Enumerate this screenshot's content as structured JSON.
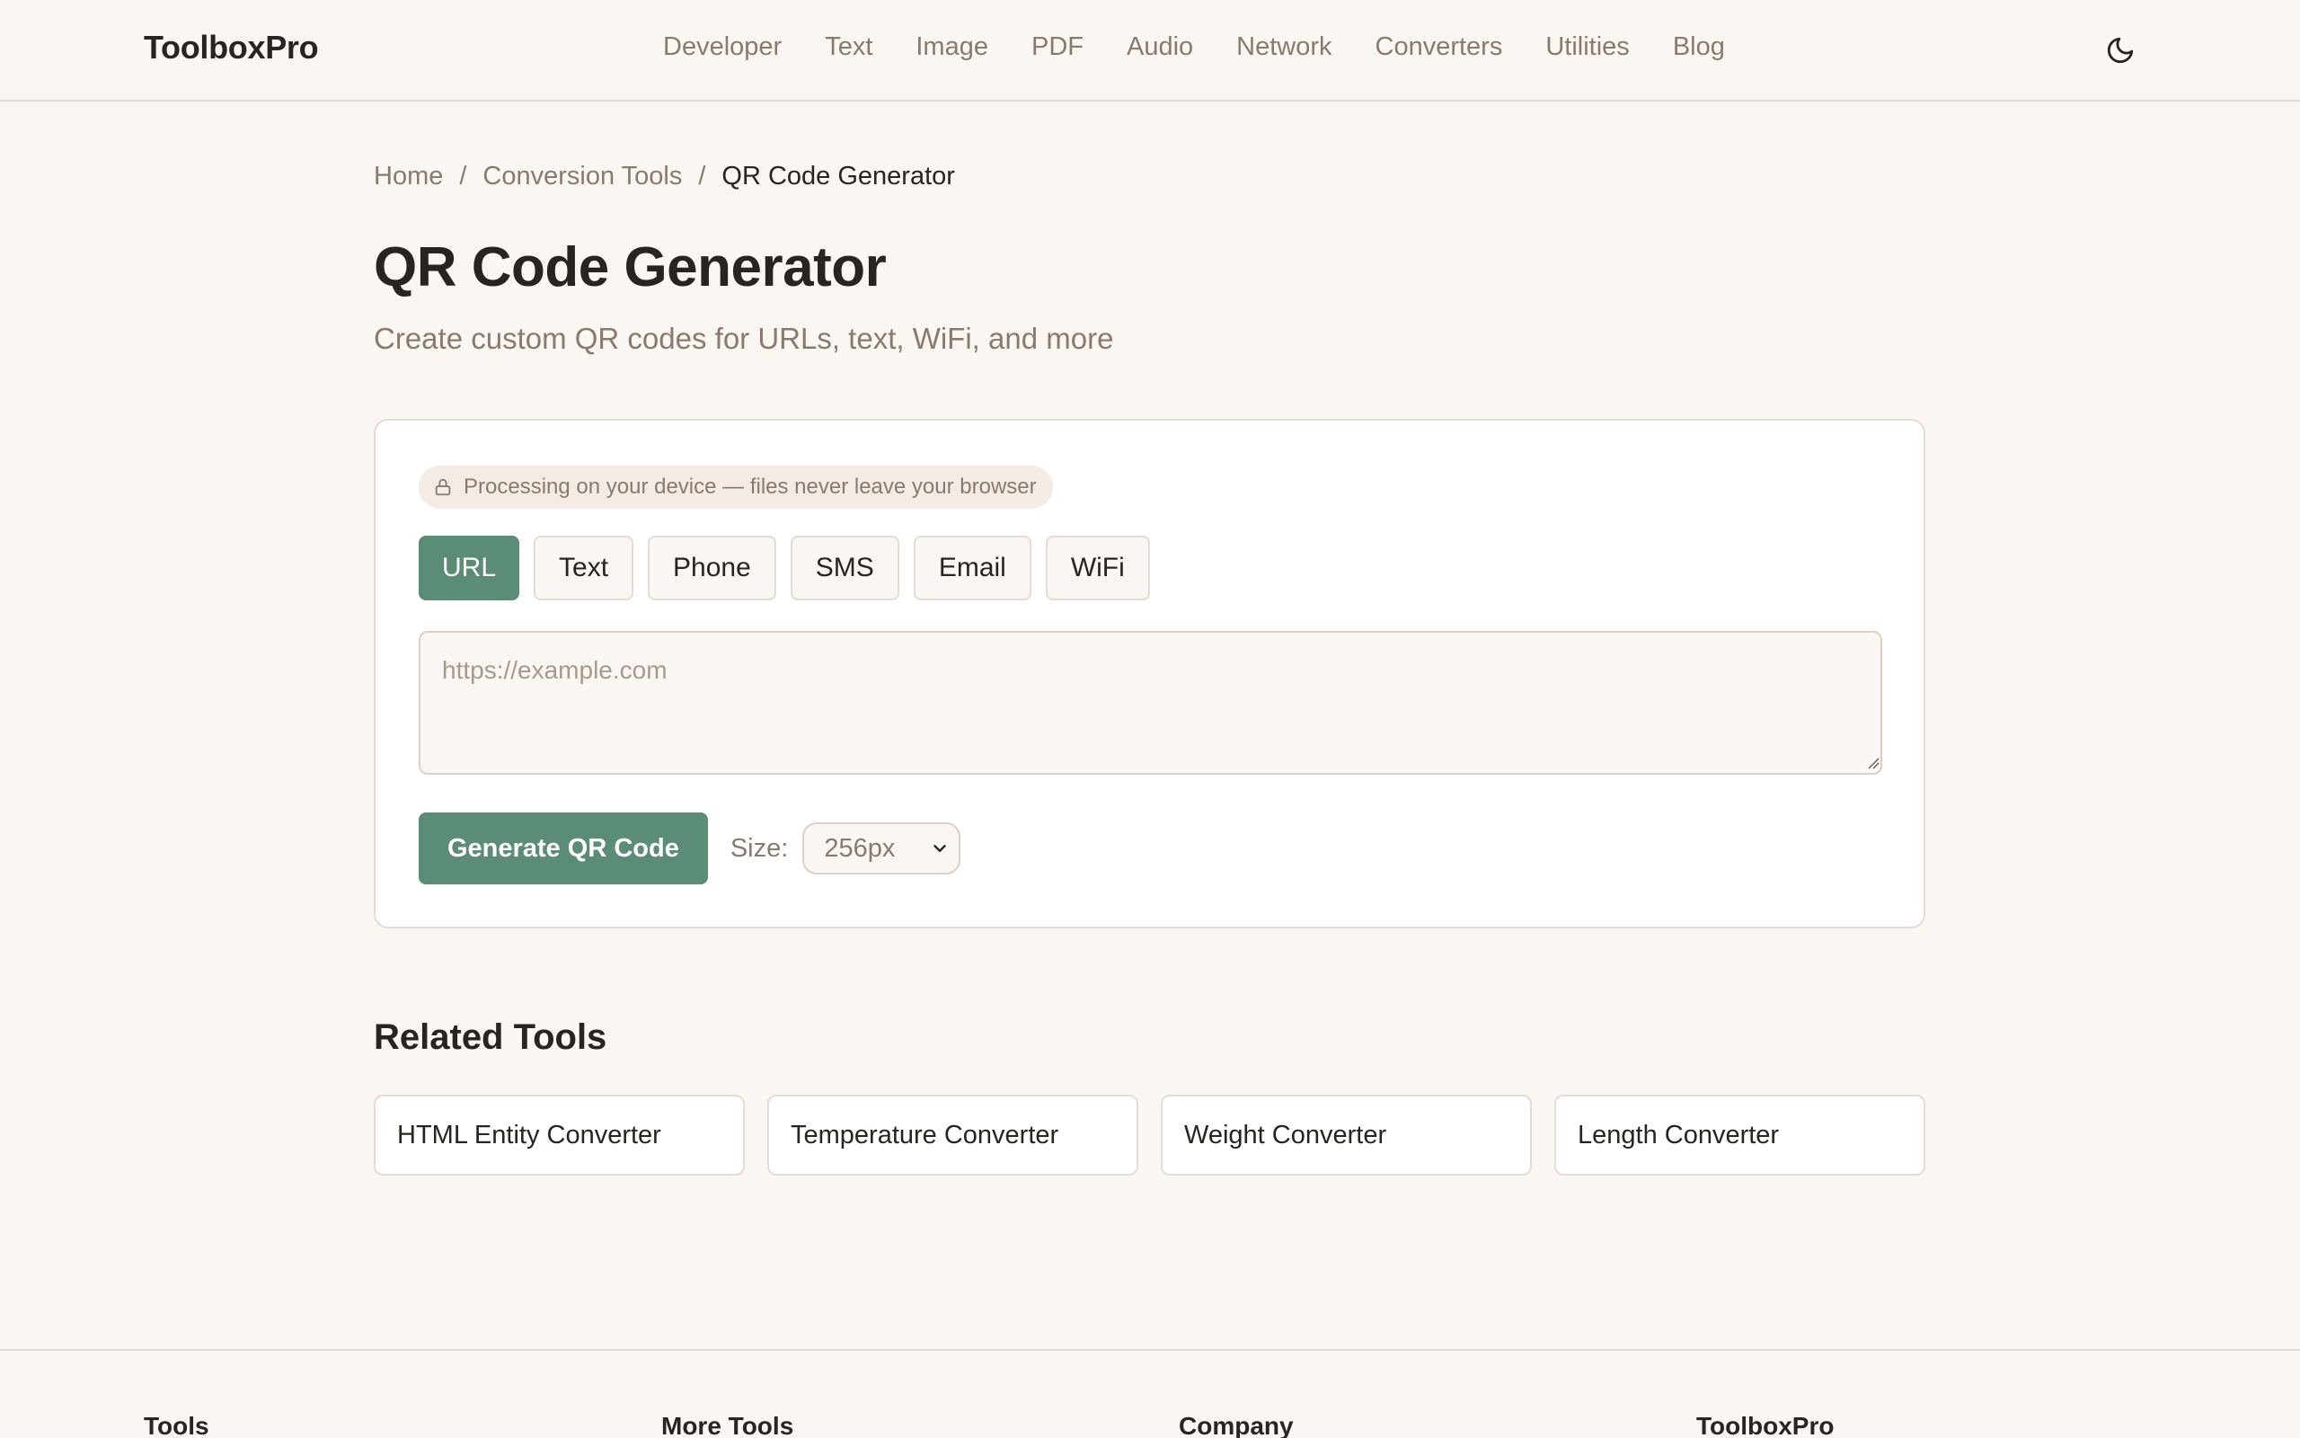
{
  "header": {
    "brand": "ToolboxPro",
    "nav": [
      "Developer",
      "Text",
      "Image",
      "PDF",
      "Audio",
      "Network",
      "Converters",
      "Utilities",
      "Blog"
    ],
    "theme_icon": "moon-icon"
  },
  "breadcrumb": {
    "home": "Home",
    "section": "Conversion Tools",
    "current": "QR Code Generator",
    "separator": "/"
  },
  "page": {
    "title": "QR Code Generator",
    "subtitle": "Create custom QR codes for URLs, text, WiFi, and more"
  },
  "tool": {
    "privacy_badge": "Processing on your device — files never leave your browser",
    "privacy_icon": "lock-icon",
    "tabs": [
      "URL",
      "Text",
      "Phone",
      "SMS",
      "Email",
      "WiFi"
    ],
    "active_tab": "URL",
    "input_value": "",
    "input_placeholder": "https://example.com",
    "generate_label": "Generate QR Code",
    "size_label": "Size:",
    "size_value": "256px"
  },
  "related": {
    "heading": "Related Tools",
    "items": [
      "HTML Entity Converter",
      "Temperature Converter",
      "Weight Converter",
      "Length Converter"
    ]
  },
  "footer": {
    "columns": [
      "Tools",
      "More Tools",
      "Company",
      "ToolboxPro"
    ]
  },
  "colors": {
    "accent": "#5b8c76",
    "background": "#faf6f2",
    "text": "#2a2420",
    "muted": "#8a7a6e"
  }
}
